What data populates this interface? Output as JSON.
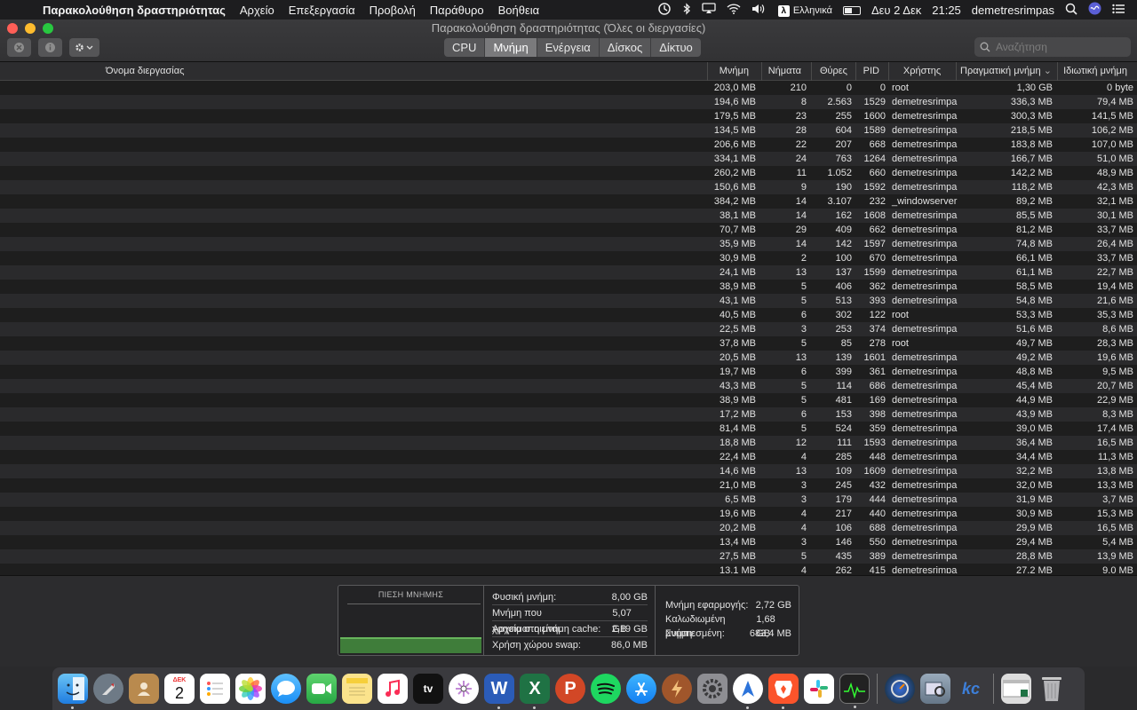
{
  "menubar": {
    "app_name": "Παρακολούθηση δραστηριότητας",
    "items": [
      "Αρχείο",
      "Επεξεργασία",
      "Προβολή",
      "Παράθυρο",
      "Βοήθεια"
    ],
    "input_source": "Ελληνικά",
    "input_source_glyph": "λ",
    "date": "Δευ 2 Δεκ",
    "time": "21:25",
    "user": "demetresrimpas"
  },
  "window": {
    "title": "Παρακολούθηση δραστηριότητας (Όλες οι διεργασίες)",
    "tabs": [
      {
        "label": "CPU",
        "active": false
      },
      {
        "label": "Μνήμη",
        "active": true
      },
      {
        "label": "Ενέργεια",
        "active": false
      },
      {
        "label": "Δίσκος",
        "active": false
      },
      {
        "label": "Δίκτυο",
        "active": false
      }
    ],
    "search_placeholder": "Αναζήτηση"
  },
  "table": {
    "headers": {
      "name": "Όνομα διεργασίας",
      "memory": "Μνήμη",
      "threads": "Νήματα",
      "ports": "Θύρες",
      "pid": "PID",
      "user": "Χρήστης",
      "real_memory": "Πραγματική μνήμη",
      "private_memory": "Ιδιωτική μνήμη"
    },
    "sort_indicator": "⌄",
    "rows": [
      [
        "203,0 MB",
        "210",
        "0",
        "0",
        "root",
        "1,30 GB",
        "0 byte"
      ],
      [
        "194,6 MB",
        "8",
        "2.563",
        "1529",
        "demetresrimpa",
        "336,3 MB",
        "79,4 MB"
      ],
      [
        "179,5 MB",
        "23",
        "255",
        "1600",
        "demetresrimpa",
        "300,3 MB",
        "141,5 MB"
      ],
      [
        "134,5 MB",
        "28",
        "604",
        "1589",
        "demetresrimpa",
        "218,5 MB",
        "106,2 MB"
      ],
      [
        "206,6 MB",
        "22",
        "207",
        "668",
        "demetresrimpa",
        "183,8 MB",
        "107,0 MB"
      ],
      [
        "334,1 MB",
        "24",
        "763",
        "1264",
        "demetresrimpa",
        "166,7 MB",
        "51,0 MB"
      ],
      [
        "260,2 MB",
        "11",
        "1.052",
        "660",
        "demetresrimpa",
        "142,2 MB",
        "48,9 MB"
      ],
      [
        "150,6 MB",
        "9",
        "190",
        "1592",
        "demetresrimpa",
        "118,2 MB",
        "42,3 MB"
      ],
      [
        "384,2 MB",
        "14",
        "3.107",
        "232",
        "_windowserver",
        "89,2 MB",
        "32,1 MB"
      ],
      [
        "38,1 MB",
        "14",
        "162",
        "1608",
        "demetresrimpa",
        "85,5 MB",
        "30,1 MB"
      ],
      [
        "70,7 MB",
        "29",
        "409",
        "662",
        "demetresrimpa",
        "81,2 MB",
        "33,7 MB"
      ],
      [
        "35,9 MB",
        "14",
        "142",
        "1597",
        "demetresrimpa",
        "74,8 MB",
        "26,4 MB"
      ],
      [
        "30,9 MB",
        "2",
        "100",
        "670",
        "demetresrimpa",
        "66,1 MB",
        "33,7 MB"
      ],
      [
        "24,1 MB",
        "13",
        "137",
        "1599",
        "demetresrimpa",
        "61,1 MB",
        "22,7 MB"
      ],
      [
        "38,9 MB",
        "5",
        "406",
        "362",
        "demetresrimpa",
        "58,5 MB",
        "19,4 MB"
      ],
      [
        "43,1 MB",
        "5",
        "513",
        "393",
        "demetresrimpa",
        "54,8 MB",
        "21,6 MB"
      ],
      [
        "40,5 MB",
        "6",
        "302",
        "122",
        "root",
        "53,3 MB",
        "35,3 MB"
      ],
      [
        "22,5 MB",
        "3",
        "253",
        "374",
        "demetresrimpa",
        "51,6 MB",
        "8,6 MB"
      ],
      [
        "37,8 MB",
        "5",
        "85",
        "278",
        "root",
        "49,7 MB",
        "28,3 MB"
      ],
      [
        "20,5 MB",
        "13",
        "139",
        "1601",
        "demetresrimpa",
        "49,2 MB",
        "19,6 MB"
      ],
      [
        "19,7 MB",
        "6",
        "399",
        "361",
        "demetresrimpa",
        "48,8 MB",
        "9,5 MB"
      ],
      [
        "43,3 MB",
        "5",
        "114",
        "686",
        "demetresrimpa",
        "45,4 MB",
        "20,7 MB"
      ],
      [
        "38,9 MB",
        "5",
        "481",
        "169",
        "demetresrimpa",
        "44,9 MB",
        "22,9 MB"
      ],
      [
        "17,2 MB",
        "6",
        "153",
        "398",
        "demetresrimpa",
        "43,9 MB",
        "8,3 MB"
      ],
      [
        "81,4 MB",
        "5",
        "524",
        "359",
        "demetresrimpa",
        "39,0 MB",
        "17,4 MB"
      ],
      [
        "18,8 MB",
        "12",
        "111",
        "1593",
        "demetresrimpa",
        "36,4 MB",
        "16,5 MB"
      ],
      [
        "22,4 MB",
        "4",
        "285",
        "448",
        "demetresrimpa",
        "34,4 MB",
        "11,3 MB"
      ],
      [
        "14,6 MB",
        "13",
        "109",
        "1609",
        "demetresrimpa",
        "32,2 MB",
        "13,8 MB"
      ],
      [
        "21,0 MB",
        "3",
        "245",
        "432",
        "demetresrimpa",
        "32,0 MB",
        "13,3 MB"
      ],
      [
        "6,5 MB",
        "3",
        "179",
        "444",
        "demetresrimpa",
        "31,9 MB",
        "3,7 MB"
      ],
      [
        "19,6 MB",
        "4",
        "217",
        "440",
        "demetresrimpa",
        "30,9 MB",
        "15,3 MB"
      ],
      [
        "20,2 MB",
        "4",
        "106",
        "688",
        "demetresrimpa",
        "29,9 MB",
        "16,5 MB"
      ],
      [
        "13,4 MB",
        "3",
        "146",
        "550",
        "demetresrimpa",
        "29,4 MB",
        "5,4 MB"
      ],
      [
        "27,5 MB",
        "5",
        "435",
        "389",
        "demetresrimpa",
        "28,8 MB",
        "13,9 MB"
      ],
      [
        "13,1 MB",
        "4",
        "262",
        "415",
        "demetresrimpa",
        "27,2 MB",
        "9,0 MB"
      ]
    ]
  },
  "memory_panel": {
    "pressure_title": "ΠΙΕΣΗ ΜΝΗΜΗΣ",
    "pressure_color": "#3f7d3a",
    "middle": [
      {
        "label": "Φυσική μνήμη:",
        "value": "8,00 GB"
      },
      {
        "label": "Μνήμη που χρησιμοποιείται:",
        "value": "5,07 GB"
      },
      {
        "label": "Αρχεία στη μνήμη cache:",
        "value": "2,19 GB"
      },
      {
        "label": "Χρήση χώρου swap:",
        "value": "86,0 MB"
      }
    ],
    "right": [
      {
        "label": "Μνήμη εφαρμογής:",
        "value": "2,72 GB"
      },
      {
        "label": "Καλωδιωμένη μνήμη:",
        "value": "1,68 GB"
      },
      {
        "label": "Συμπιεσμένη:",
        "value": "683,4 MB"
      }
    ]
  },
  "dock": {
    "calendar_month": "ΔΕΚ",
    "calendar_day": "2",
    "tv_label": "tv",
    "word_label": "W",
    "excel_label": "X",
    "powerpoint_label": "P",
    "kc_label": "kc"
  }
}
